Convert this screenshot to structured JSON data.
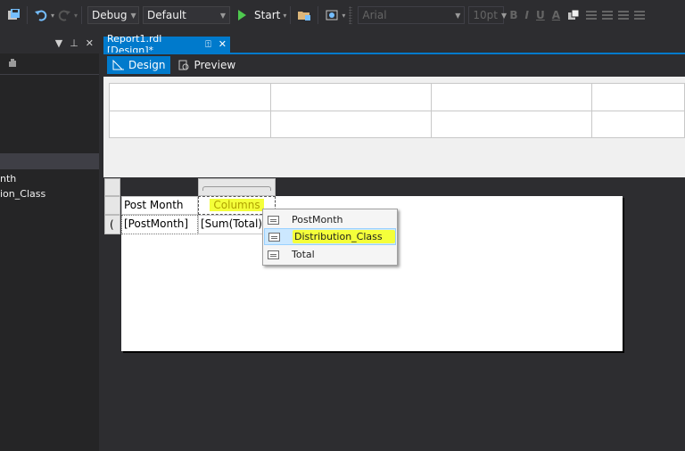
{
  "toolbar": {
    "config": "Debug",
    "platform": "Default",
    "start_label": "Start",
    "font_name": "Arial",
    "font_size": "10pt",
    "bold": "B",
    "italic": "I",
    "underline": "U",
    "font_color": "A"
  },
  "left_panel": {
    "items": [
      "nth",
      "ion_Class"
    ]
  },
  "doc_tab": {
    "title": "Report1.rdl [Design]*",
    "pin": "⍐",
    "close": "✕"
  },
  "view_tabs": {
    "design": "Design",
    "preview": "Preview"
  },
  "tablix": {
    "header_left": "Post Month",
    "header_right": "Columns",
    "row_left": "[PostMonth]",
    "row_right": "[Sum(Total)]",
    "row_handle": "("
  },
  "field_popup": {
    "items": [
      "PostMonth",
      "Distribution_Class",
      "Total"
    ],
    "selected": "Distribution_Class"
  },
  "colors": {
    "accent": "#007acc",
    "highlight": "#f4ff3a",
    "background": "#2d2d30"
  }
}
